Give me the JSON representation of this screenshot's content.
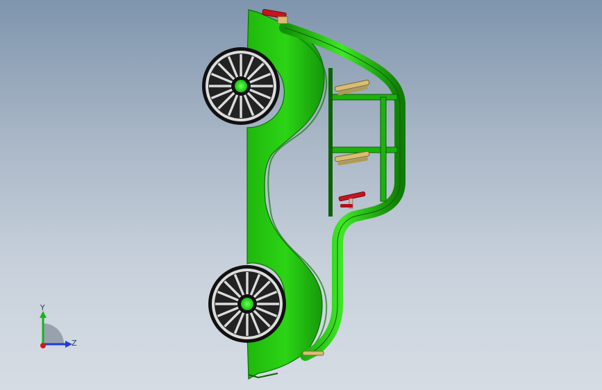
{
  "viewport": {
    "background_top": "#7f95ad",
    "background_bottom": "#d5dce4"
  },
  "model": {
    "body_color": "#22c20f",
    "body_dark": "#118a05",
    "wheel_color": "#1a1a1a",
    "hub_color": "#22e014",
    "seat_color": "#d9c27a",
    "accent_red": "#c8141e"
  },
  "triad": {
    "y_label": "Y",
    "z_label": "Z",
    "y_color": "#19b319",
    "z_color": "#1e3bd6",
    "x_color": "#d11a1a"
  }
}
